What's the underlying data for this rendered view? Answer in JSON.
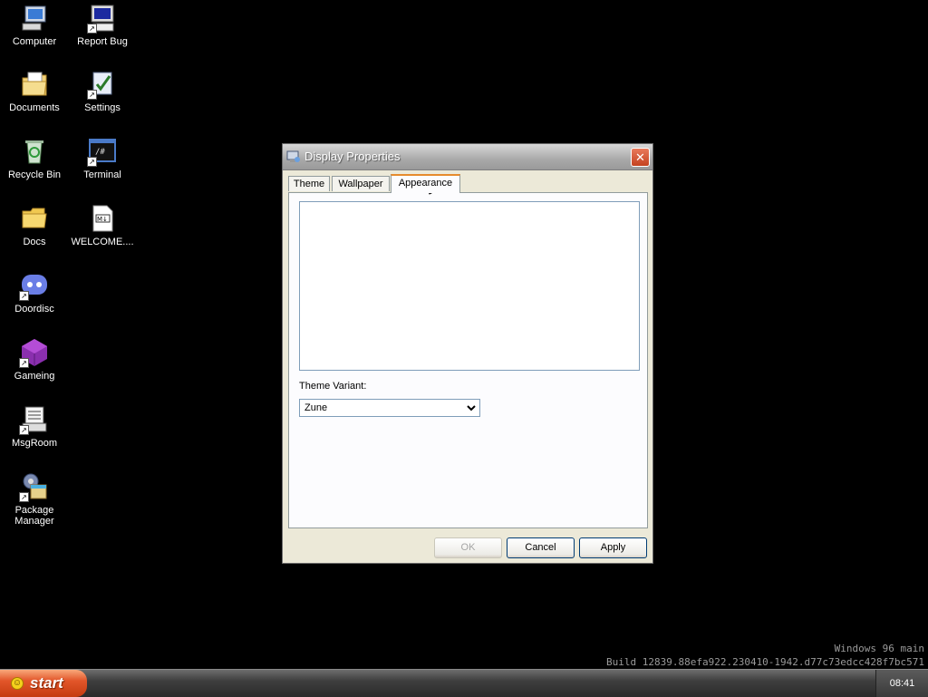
{
  "desktop": {
    "icons": [
      {
        "label": "Computer",
        "icon": "computer-icon"
      },
      {
        "label": "Report Bug",
        "icon": "report-bug-icon"
      },
      {
        "label": "Documents",
        "icon": "documents-icon"
      },
      {
        "label": "Settings",
        "icon": "settings-icon"
      },
      {
        "label": "Recycle Bin",
        "icon": "recycle-bin-icon"
      },
      {
        "label": "Terminal",
        "icon": "terminal-icon"
      },
      {
        "label": "Docs",
        "icon": "folder-icon"
      },
      {
        "label": "WELCOME....",
        "icon": "markdown-file-icon"
      },
      {
        "label": "Doordisc",
        "icon": "doordisc-icon"
      },
      {
        "label": "Gameing",
        "icon": "gameing-icon"
      },
      {
        "label": "MsgRoom",
        "icon": "msgroom-icon"
      },
      {
        "label": "Package Manager",
        "icon": "package-manager-icon"
      }
    ]
  },
  "dialog": {
    "title": "Display Properties",
    "tabs": [
      "Theme",
      "Wallpaper",
      "Appearance"
    ],
    "active_tab": "Appearance",
    "variant_label": "Theme Variant:",
    "variant_value": "Zune",
    "buttons": {
      "ok": "OK",
      "cancel": "Cancel",
      "apply": "Apply"
    }
  },
  "watermark": {
    "line1": "Windows 96 main",
    "line2": "Build 12839.88efa922.230410-1942.d77c73edcc428f7bc571"
  },
  "taskbar": {
    "start_label": "start",
    "clock": "08:41"
  },
  "colors": {
    "desktop": "#000000",
    "start": "#e2562a",
    "active_tab_accent": "#e68b2c",
    "close_button": "#c4421f"
  }
}
